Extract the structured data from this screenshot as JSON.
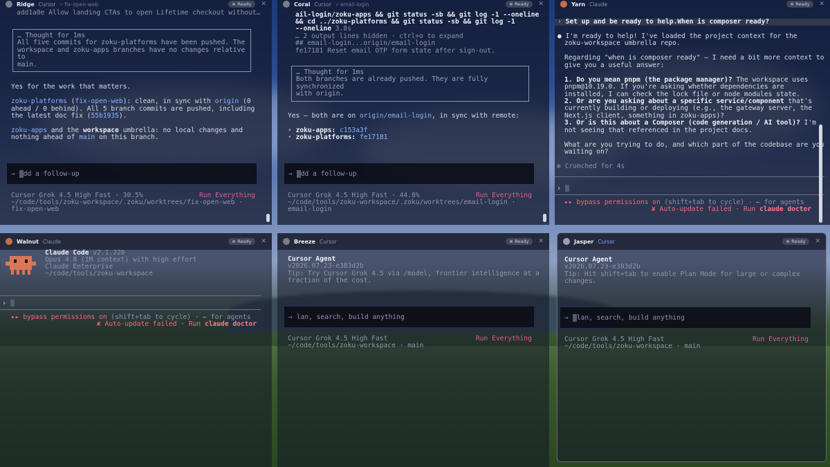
{
  "ridge": {
    "title": {
      "name": "Ridge",
      "kind": "Cursor",
      "branch": "fix-open-web",
      "ready": "Ready"
    },
    "top_line": "add1a0e Allow landing CTAs to open Lifetime checkout without…",
    "thought": "… Thought for 1ms\nAll five commits for zoku-platforms have been pushed. The\nworkspace and zoku-apps branches have no changes relative\nto\nmain.",
    "l1": "Yes for the work that matters.",
    "p1a": "zoku-platforms",
    "p1b": " (",
    "p1c": "fix-open-web",
    "p1d": "): clean, in sync with ",
    "p1e": "origin",
    "p1f": " (0",
    "p2": "ahead / 0 behind). All 5 branch commits are pushed, including",
    "p3a": "the latest doc fix (",
    "p3b": "55b1935",
    "p3c": ").",
    "p4a": "zoku-apps",
    "p4b": " and the ",
    "p4c": "workspace",
    "p4d": " umbrella: no local changes and",
    "p5a": "nothing ahead of ",
    "p5b": "main",
    "p5c": " on this branch.",
    "prompt": "dd a follow-up",
    "model": "Cursor Grok 4.5 High Fast · 30.5%",
    "run": "Run Everything",
    "path1": "~/code/tools/zoku-workspace/.zoku/worktrees/fix-open-web ·",
    "path2": "fix-open-web"
  },
  "coral": {
    "title": {
      "name": "Coral",
      "kind": "Cursor",
      "branch": "email-login",
      "ready": "Ready"
    },
    "l1": "ail-login/zoku-apps && git status -sb && git log -1 --oneline",
    "l2": "&& cd ../zoku-platforms && git status -sb && git log -1",
    "l3a": "--oneline",
    "l3b": " 3.8s",
    "l4": "… 2 output lines hidden · ctrl+o to expand",
    "l5": "## email-login...origin/email-login",
    "l6": "fe17181 Reset email OTP form state after sign-out.",
    "thought": "… Thought for 1ms\nBoth branches are already pushed. They are fully\nsynchronized\nwith origin.",
    "y1a": "Yes — both are on ",
    "y1b": "origin/email-login",
    "y1c": ", in sync with remote:",
    "b1a": "zoku-apps:",
    "b1b": " c153a3f",
    "b2a": "zoku-platforms:",
    "b2b": " fe17181",
    "prompt": "dd a follow-up",
    "model": "Cursor Grok 4.5 High Fast · 44.8%",
    "run": "Run Everything",
    "path1": "~/code/tools/zoku-workspace/.zoku/worktrees/email-login ·",
    "path2": "email-login"
  },
  "yarn": {
    "title": {
      "name": "Yarn",
      "kind": "Claude",
      "ready": "Ready"
    },
    "user": "Set up and be ready to help.When is composer ready?",
    "r1": "I'm ready to help! I've loaded the project context for the",
    "r2": "zoku-workspace umbrella repo.",
    "r3": "Regarding \"when is composer ready\" — I need a bit more context to",
    "r4": "give you a useful answer:",
    "q1a": "1. Do you mean ",
    "q1b": "pnpm",
    "q1c": " (the package manager)?",
    "q1d": " The workspace uses",
    "q1e": "pnpm@10.19.0. If you're asking whether dependencies are",
    "q1f": "installed, I can check the lock file or node_modules state.",
    "q2a": "2. Or are you asking about a specific service/component",
    "q2b": " that's",
    "q2c": "currently building or deploying (e.g., the gateway server, the",
    "q2d": "Next.js client, something in zoku-apps)?",
    "q3a": "3. Or is this about a Composer (code generation / AI tool)?",
    "q3b": " I'm",
    "q3c": "not seeing that referenced in the project docs.",
    "w1": "What are you trying to do, and which part of the codebase are you",
    "w2": "waiting on?",
    "crunched": "Crunched for 4s",
    "perm": "▸▸ bypass permissions on",
    "perm2": " (shift+tab to cycle) · ← for agents",
    "upd": "✘ Auto-update failed · Run ",
    "upd2": "claude doctor"
  },
  "walnut": {
    "title": {
      "name": "Walnut",
      "kind": "Claude",
      "ready": "Ready"
    },
    "app": "Claude Code",
    "version": " v2.1.220",
    "m1": "Opus 4.8 (1M context) with high effort",
    "m2": "Claude Enterprise",
    "m3": "~/code/tools/zoku-workspace",
    "perm": "▸▸ bypass permissions on",
    "perm2": " (shift+tab to cycle) · ← for agents",
    "upd": "✘ Auto-update failed · Run ",
    "upd2": "claude doctor"
  },
  "breeze": {
    "title": {
      "name": "Breeze",
      "kind": "Cursor",
      "ready": "Ready"
    },
    "app": "Cursor Agent",
    "ver": "v2026.07.23-e383d2b",
    "tip1": "Tip: Try Cursor Grok 4.5 via /model, frontier intelligence at a",
    "tip2": "fraction of the cost.",
    "prompt": "lan, search, build anything",
    "model": "Cursor Grok 4.5 High Fast",
    "run": "Run Everything",
    "path": "~/code/tools/zoku-workspace · main"
  },
  "jasper": {
    "title": {
      "name": "Jasper",
      "kind": "Cursor",
      "ready": "Ready"
    },
    "app": "Cursor Agent",
    "ver": "v2026.07.23-e383d2b",
    "tip1": "Tip: Hit shift+tab to enable Plan Mode for large or complex",
    "tip2": "changes.",
    "prompt": "lan, search, build anything",
    "model": "Cursor Grok 4.5 High Fast",
    "run": "Run Everything",
    "path": "~/code/tools/zoku-workspace · main"
  },
  "colors": {
    "accent": "#8ab4ff",
    "warn": "#f06a7a",
    "run": "#e25a8a",
    "bg": "#12162a"
  }
}
